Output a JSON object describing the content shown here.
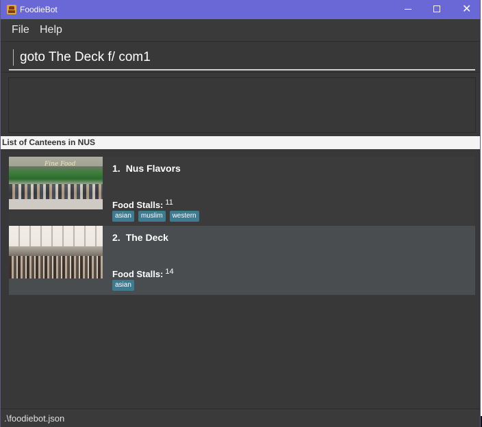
{
  "window": {
    "title": "FoodieBot",
    "controls": {
      "minimize": "",
      "maximize": "",
      "close": "✕"
    }
  },
  "menu": {
    "file": "File",
    "help": "Help"
  },
  "command": {
    "value": "goto The Deck f/ com1"
  },
  "result": {
    "text": ""
  },
  "list": {
    "title": "List of Canteens in NUS",
    "canteens": [
      {
        "index": "1.",
        "name": "Nus Flavors",
        "stalls_label": "Food Stalls:",
        "stalls_count": "11",
        "tags": [
          "asian",
          "muslim",
          "western"
        ],
        "image_sign": "Fine Food"
      },
      {
        "index": "2.",
        "name": "The Deck",
        "stalls_label": "Food Stalls:",
        "stalls_count": "14",
        "tags": [
          "asian"
        ]
      }
    ]
  },
  "status": {
    "path": ".\\foodiebot.json"
  },
  "colors": {
    "titlebar": "#6a67d6",
    "background": "#383838",
    "selected_card": "#4a4d4f",
    "tag": "#3e7b91"
  },
  "icons": [
    "app-icon",
    "minimize-icon",
    "maximize-icon",
    "close-icon"
  ]
}
